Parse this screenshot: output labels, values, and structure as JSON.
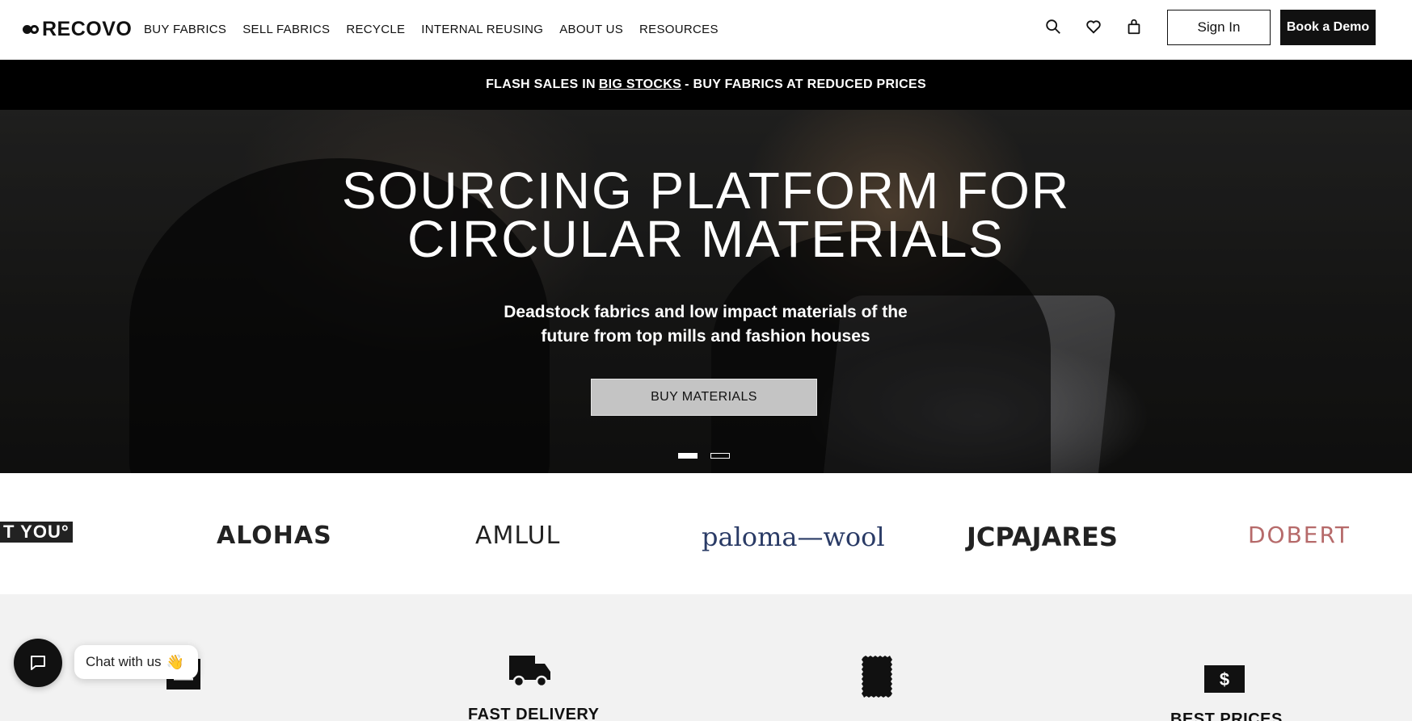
{
  "header": {
    "logo": "RECOVO",
    "nav": [
      "BUY FABRICS",
      "SELL FABRICS",
      "RECYCLE",
      "INTERNAL REUSING",
      "ABOUT US",
      "RESOURCES"
    ],
    "icons": [
      "search-icon",
      "heart-icon",
      "bag-icon"
    ],
    "sign_in": "Sign In",
    "book_demo": "Book a Demo"
  },
  "promo": {
    "prefix": "FLASH SALES IN",
    "link": "BIG STOCKS",
    "suffix": "- BUY FABRICS AT REDUCED PRICES"
  },
  "hero": {
    "title_line1": "SOURCING PLATFORM FOR",
    "title_line2": "CIRCULAR MATERIALS",
    "subtitle_line1": "Deadstock fabrics and low impact materials of the",
    "subtitle_line2": "future from top mills and fashion houses",
    "cta": "BUY MATERIALS",
    "slides": 2,
    "active_slide": 1
  },
  "brands": [
    "T YOU°",
    "ALOHAS",
    "AMLUL",
    "paloma—wool",
    "JCPAJARES",
    "DOBERT"
  ],
  "features": {
    "items": [
      {
        "icon": "menu-icon",
        "title": ""
      },
      {
        "icon": "truck-icon",
        "title": "FAST DELIVERY"
      },
      {
        "icon": "fabric-swatch-icon",
        "title": ""
      },
      {
        "icon": "dollar-bill-icon",
        "title": "BEST PRICES"
      }
    ]
  },
  "chat": {
    "label": "Chat with us",
    "emoji": "👋"
  },
  "colors": {
    "primary": "#111111",
    "promo_bg": "#000000",
    "hero_button_bg": "#c4c4c4",
    "features_bg": "#f2f2f2"
  }
}
